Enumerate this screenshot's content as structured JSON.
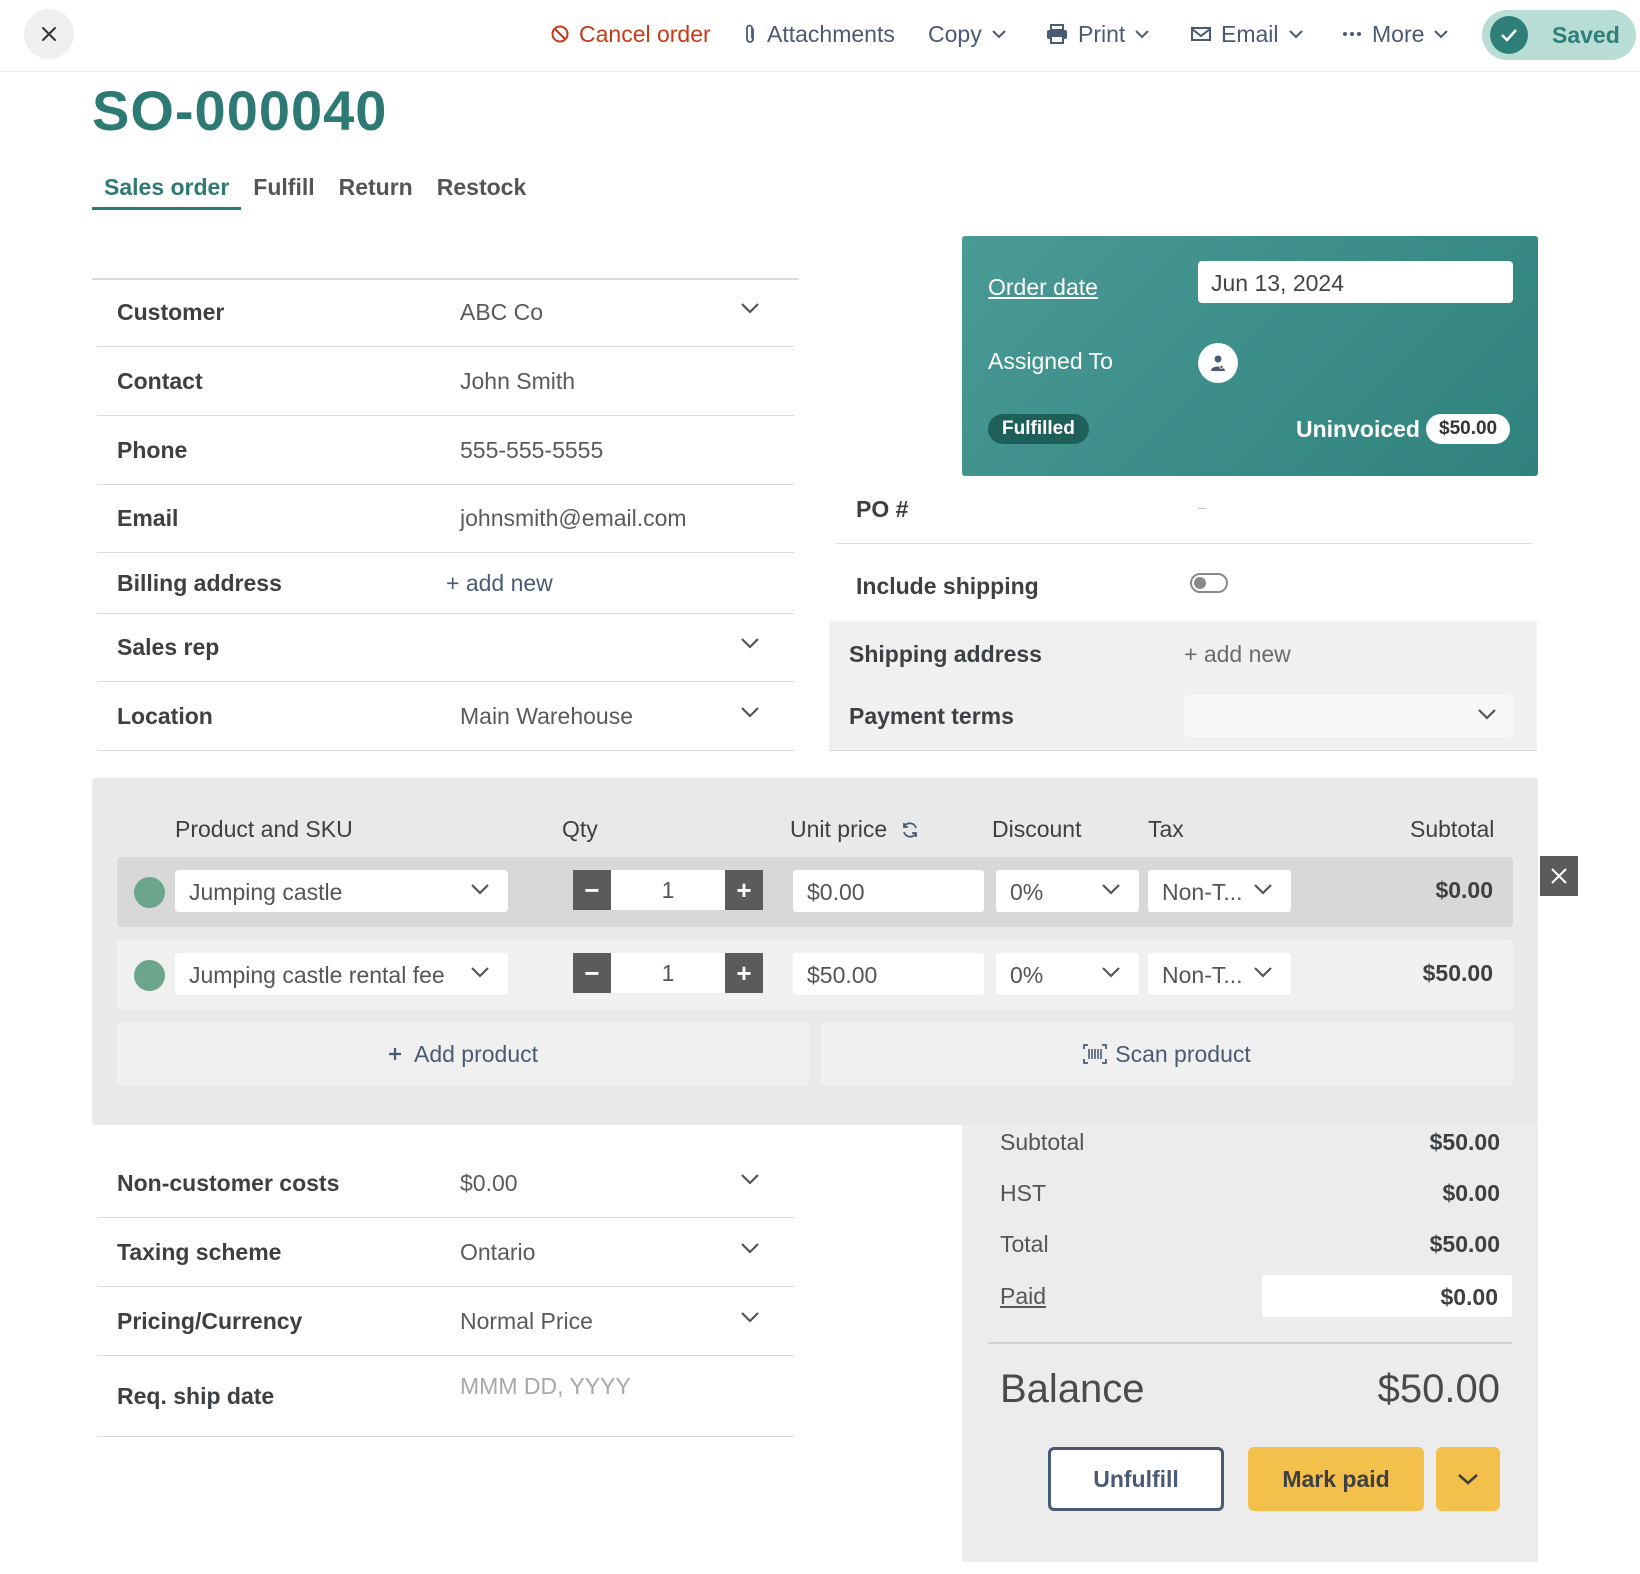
{
  "toolbar": {
    "cancel_label": "Cancel order",
    "attachments_label": "Attachments",
    "copy_label": "Copy",
    "print_label": "Print",
    "email_label": "Email",
    "more_label": "More",
    "saved_label": "Saved"
  },
  "order": {
    "number": "SO-000040"
  },
  "tabs": [
    "Sales order",
    "Fulfill",
    "Return",
    "Restock"
  ],
  "fields": {
    "customer": {
      "label": "Customer",
      "value": "ABC Co"
    },
    "contact": {
      "label": "Contact",
      "value": "John Smith"
    },
    "phone": {
      "label": "Phone",
      "value": "555-555-5555"
    },
    "email": {
      "label": "Email",
      "value": "johnsmith@email.com"
    },
    "billing": {
      "label": "Billing address",
      "value": "+ add new"
    },
    "sales_rep": {
      "label": "Sales rep",
      "value": ""
    },
    "location": {
      "label": "Location",
      "value": "Main Warehouse"
    }
  },
  "card": {
    "order_date_label": "Order date",
    "order_date_value": "Jun 13, 2024",
    "assigned_label": "Assigned To",
    "status_badge": "Fulfilled",
    "uninvoiced_label": "Uninvoiced",
    "uninvoiced_amount": "$50.00"
  },
  "right_fields": {
    "po_label": "PO #",
    "include_shipping_label": "Include shipping",
    "include_shipping_on": false,
    "shipping_address_label": "Shipping address",
    "shipping_address_value": "+ add new",
    "payment_terms_label": "Payment terms",
    "payment_terms_value": ""
  },
  "products": {
    "headers": {
      "product": "Product and SKU",
      "qty": "Qty",
      "unit_price": "Unit price",
      "discount": "Discount",
      "tax": "Tax",
      "subtotal": "Subtotal"
    },
    "rows": [
      {
        "product": "Jumping castle",
        "qty": "1",
        "unit_price": "$0.00",
        "discount": "0%",
        "tax": "Non-T...",
        "subtotal": "$0.00"
      },
      {
        "product": "Jumping castle rental fee",
        "qty": "1",
        "unit_price": "$50.00",
        "discount": "0%",
        "tax": "Non-T...",
        "subtotal": "$50.00"
      }
    ],
    "add_label": "Add product",
    "scan_label": "Scan product"
  },
  "extra_fields": {
    "non_customer_costs": {
      "label": "Non-customer costs",
      "value": "$0.00"
    },
    "taxing_scheme": {
      "label": "Taxing scheme",
      "value": "Ontario"
    },
    "pricing_currency": {
      "label": "Pricing/Currency",
      "value": "Normal Price"
    },
    "req_ship_date": {
      "label": "Req. ship date",
      "placeholder": "MMM DD, YYYY"
    }
  },
  "totals": {
    "subtotal_label": "Subtotal",
    "subtotal_value": "$50.00",
    "hst_label": "HST",
    "hst_value": "$0.00",
    "total_label": "Total",
    "total_value": "$50.00",
    "paid_label": "Paid",
    "paid_value": "$0.00",
    "balance_label": "Balance",
    "balance_value": "$50.00"
  },
  "actions": {
    "unfulfill_label": "Unfulfill",
    "mark_paid_label": "Mark paid"
  },
  "colors": {
    "brand_teal": "#2d7a74",
    "cancel_red": "#c73a16",
    "link_slate": "#4a5a74",
    "accent_yellow": "#f3c04b"
  },
  "icons": {
    "close": "close-icon",
    "cancel": "prohibit-icon",
    "attachments": "paperclip-icon",
    "print": "printer-icon",
    "email": "envelope-icon",
    "more": "ellipsis-icon",
    "saved": "check-icon",
    "refresh": "refresh-icon",
    "scan": "barcode-icon",
    "assignee": "user-icon"
  }
}
